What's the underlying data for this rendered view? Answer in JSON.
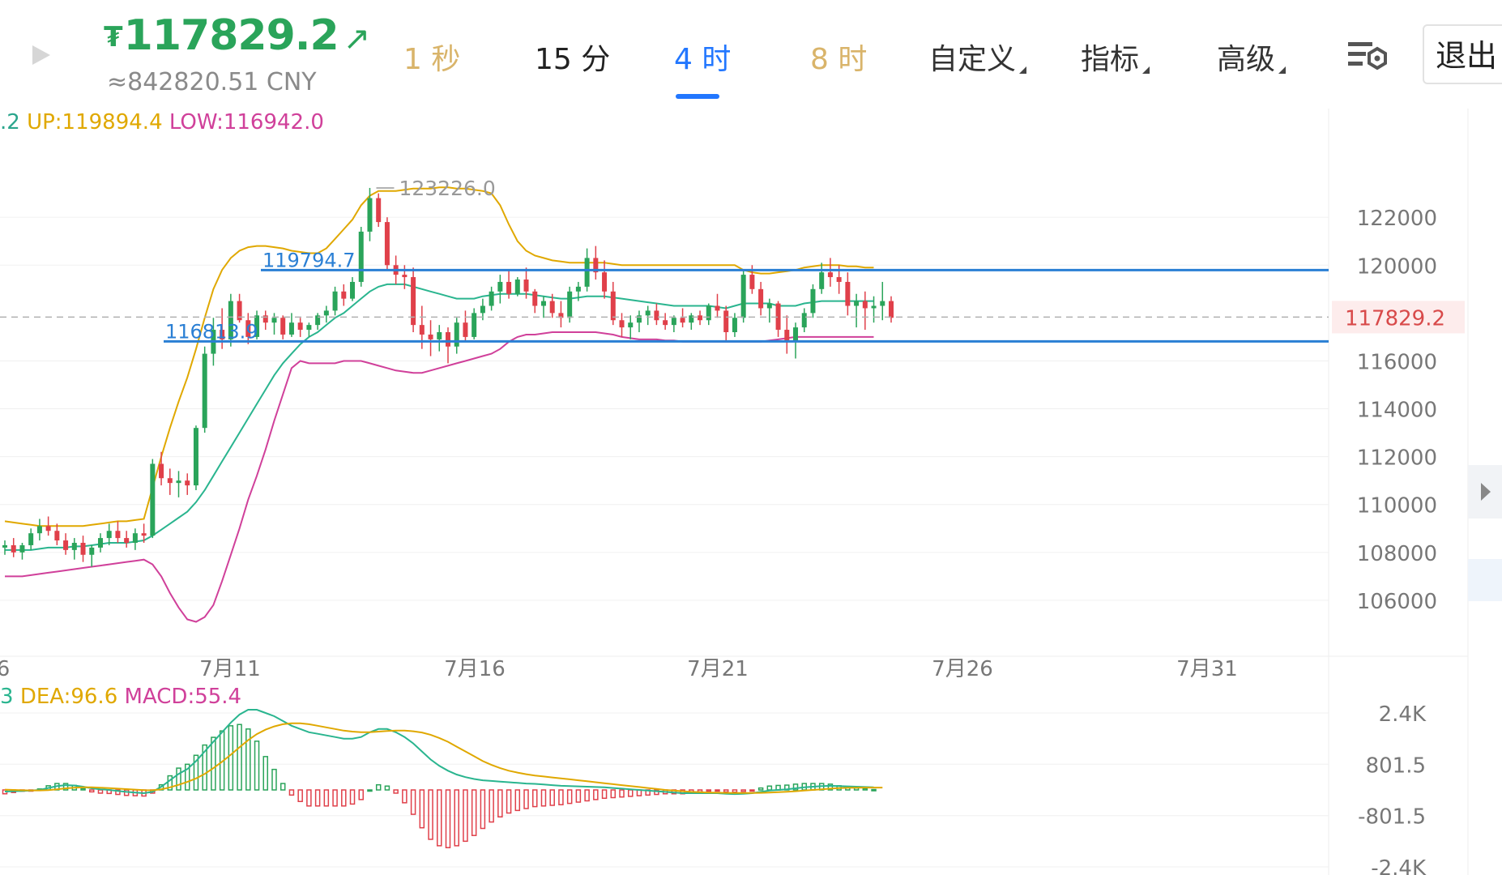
{
  "header": {
    "currency_symbol": "₮",
    "price": "117829.2",
    "price_arrow": "↗",
    "cny_value": "≈842820.51 CNY",
    "price_color": "#2aa45a"
  },
  "timeframes": [
    {
      "label": "1 秒",
      "state": "gold"
    },
    {
      "label": "15 分",
      "state": "normal"
    },
    {
      "label": "4 时",
      "state": "active"
    },
    {
      "label": "8 时",
      "state": "gold"
    }
  ],
  "menus": {
    "custom": "自定义",
    "indicators": "指标",
    "advanced": "高级"
  },
  "exit_label": "退出",
  "legend": {
    "mid_fragment": ".2",
    "up": "UP:119894.4",
    "low": "LOW:116942.0",
    "up_color": "#e0a800",
    "low_color": "#d0409a",
    "mid_color": "#2aa58c"
  },
  "macd_legend": {
    "dif_fragment": "3",
    "dea": "DEA:96.6",
    "macd": "MACD:55.4"
  },
  "annotations": {
    "high_marker": "123226.0",
    "resistance_label": "119794.7",
    "support_label": "116813.9",
    "current_price_tag": "117829.2"
  },
  "colors": {
    "up_candle": "#2aa45a",
    "down_candle": "#e0404a",
    "boll_upper": "#e0a800",
    "boll_mid": "#2ab58f",
    "boll_lower": "#d0409a",
    "level_line": "#2a7fd4",
    "grid": "#f0f0f0",
    "axis_text": "#777777"
  },
  "chart_data": {
    "type": "candlestick",
    "y_ticks": [
      122000,
      120000,
      116000,
      114000,
      112000,
      110000,
      108000,
      106000
    ],
    "y_range": [
      104000,
      126000
    ],
    "x_ticks": [
      "6",
      "7月11",
      "7月16",
      "7月21",
      "7月26",
      "7月31"
    ],
    "horizontal_levels": [
      119794.7,
      116813.9
    ],
    "current_price": 117829.2,
    "max_high": 123226.0,
    "candles_ohlc": [
      [
        108200,
        108500,
        107900,
        108300
      ],
      [
        108300,
        108600,
        107800,
        108000
      ],
      [
        108000,
        108400,
        107700,
        108300
      ],
      [
        108300,
        109000,
        108100,
        108800
      ],
      [
        108800,
        109400,
        108500,
        109100
      ],
      [
        109100,
        109500,
        108700,
        108900
      ],
      [
        108900,
        109200,
        108300,
        108500
      ],
      [
        108500,
        108800,
        107900,
        108100
      ],
      [
        108100,
        108600,
        107700,
        108400
      ],
      [
        108400,
        108700,
        107600,
        107900
      ],
      [
        107900,
        108300,
        107400,
        108200
      ],
      [
        108200,
        108800,
        108000,
        108600
      ],
      [
        108600,
        109200,
        108300,
        108900
      ],
      [
        108900,
        109300,
        108400,
        108600
      ],
      [
        108600,
        108900,
        108200,
        108400
      ],
      [
        108400,
        109000,
        108100,
        108800
      ],
      [
        108800,
        109200,
        108400,
        108700
      ],
      [
        108700,
        111900,
        108600,
        111700
      ],
      [
        111700,
        112200,
        110800,
        111100
      ],
      [
        111100,
        111500,
        110400,
        110900
      ],
      [
        110900,
        111400,
        110300,
        111000
      ],
      [
        111000,
        111300,
        110400,
        110800
      ],
      [
        110800,
        113300,
        110600,
        113200
      ],
      [
        113200,
        116600,
        113000,
        116300
      ],
      [
        116300,
        117800,
        115800,
        117300
      ],
      [
        117300,
        118200,
        116500,
        116900
      ],
      [
        116900,
        118800,
        116600,
        118500
      ],
      [
        118500,
        118800,
        117600,
        117700
      ],
      [
        117700,
        118000,
        116700,
        117000
      ],
      [
        117000,
        118100,
        116900,
        117900
      ],
      [
        117900,
        118100,
        117300,
        117600
      ],
      [
        117600,
        118000,
        117100,
        117800
      ],
      [
        117800,
        117900,
        116900,
        117100
      ],
      [
        117100,
        118000,
        117000,
        117600
      ],
      [
        117600,
        117800,
        117000,
        117300
      ],
      [
        117300,
        117600,
        117000,
        117500
      ],
      [
        117500,
        118000,
        117300,
        117900
      ],
      [
        117900,
        118300,
        117600,
        118100
      ],
      [
        118100,
        119100,
        117900,
        118900
      ],
      [
        118900,
        119200,
        118300,
        118600
      ],
      [
        118600,
        119500,
        118500,
        119300
      ],
      [
        119300,
        121600,
        119100,
        121400
      ],
      [
        121400,
        123226,
        121000,
        122800
      ],
      [
        122800,
        123000,
        121600,
        121800
      ],
      [
        121800,
        122000,
        119800,
        120000
      ],
      [
        120000,
        120400,
        119200,
        119600
      ],
      [
        119600,
        120000,
        119000,
        119500
      ],
      [
        119500,
        119900,
        117200,
        117500
      ],
      [
        117500,
        118300,
        116500,
        117100
      ],
      [
        117100,
        117700,
        116200,
        116900
      ],
      [
        116900,
        117500,
        116400,
        117200
      ],
      [
        117200,
        117400,
        115900,
        116600
      ],
      [
        116600,
        117800,
        116300,
        117600
      ],
      [
        117600,
        118100,
        116800,
        117000
      ],
      [
        117000,
        118200,
        116900,
        118000
      ],
      [
        118000,
        118600,
        117700,
        118300
      ],
      [
        118300,
        119100,
        118100,
        118900
      ],
      [
        118900,
        119600,
        118400,
        119300
      ],
      [
        119300,
        119800,
        118600,
        118800
      ],
      [
        118800,
        119500,
        118700,
        119400
      ],
      [
        119400,
        119900,
        118600,
        118900
      ],
      [
        118900,
        119000,
        118000,
        118300
      ],
      [
        118300,
        118700,
        117800,
        118500
      ],
      [
        118500,
        118800,
        117800,
        118000
      ],
      [
        118000,
        118500,
        117400,
        117800
      ],
      [
        117800,
        119100,
        117600,
        118900
      ],
      [
        118900,
        119300,
        118500,
        119100
      ],
      [
        119100,
        120700,
        118900,
        120300
      ],
      [
        120300,
        120800,
        119400,
        119700
      ],
      [
        119700,
        120200,
        118600,
        118900
      ],
      [
        118900,
        119300,
        117500,
        117700
      ],
      [
        117700,
        118000,
        117000,
        117400
      ],
      [
        117400,
        117900,
        116900,
        117600
      ],
      [
        117600,
        118100,
        117200,
        117900
      ],
      [
        117900,
        118300,
        117500,
        118100
      ],
      [
        118100,
        118400,
        117500,
        117700
      ],
      [
        117700,
        118000,
        117300,
        117500
      ],
      [
        117500,
        117900,
        117200,
        117800
      ],
      [
        117800,
        118200,
        117400,
        117600
      ],
      [
        117600,
        118000,
        117300,
        117900
      ],
      [
        117900,
        118100,
        117500,
        117700
      ],
      [
        117700,
        118400,
        117500,
        118300
      ],
      [
        118300,
        118800,
        117800,
        118100
      ],
      [
        118100,
        118300,
        116800,
        117200
      ],
      [
        117200,
        118000,
        117000,
        117800
      ],
      [
        117800,
        119800,
        117600,
        119600
      ],
      [
        119600,
        120000,
        118800,
        119000
      ],
      [
        119000,
        119300,
        117900,
        118200
      ],
      [
        118200,
        118600,
        117600,
        118400
      ],
      [
        118400,
        118500,
        117000,
        117300
      ],
      [
        117300,
        117900,
        116300,
        116800
      ],
      [
        116800,
        117600,
        116100,
        117400
      ],
      [
        117400,
        118200,
        117200,
        118000
      ],
      [
        118000,
        119200,
        117800,
        119000
      ],
      [
        119000,
        120100,
        118800,
        119700
      ],
      [
        119700,
        120300,
        119100,
        119500
      ],
      [
        119500,
        120000,
        118800,
        119300
      ],
      [
        119300,
        119700,
        117900,
        118300
      ],
      [
        118300,
        118800,
        117400,
        118500
      ],
      [
        118500,
        118900,
        117300,
        118200
      ],
      [
        118200,
        118700,
        117600,
        118300
      ],
      [
        118300,
        119300,
        117700,
        118500
      ],
      [
        118500,
        118700,
        117600,
        117800
      ]
    ],
    "boll_upper": [
      109300,
      109250,
      109200,
      109150,
      109100,
      109100,
      109100,
      109100,
      109100,
      109100,
      109150,
      109200,
      109250,
      109300,
      109300,
      109350,
      109400,
      110700,
      112000,
      113200,
      114300,
      115300,
      116500,
      117800,
      119000,
      119800,
      120300,
      120600,
      120750,
      120800,
      120800,
      120750,
      120700,
      120600,
      120550,
      120500,
      120500,
      120700,
      121100,
      121500,
      121900,
      122500,
      122900,
      123100,
      123100,
      123100,
      123150,
      123200,
      123200,
      123200,
      123250,
      123250,
      123200,
      123200,
      123150,
      123100,
      123000,
      122500,
      121700,
      121000,
      120600,
      120400,
      120300,
      120200,
      120150,
      120100,
      120100,
      120100,
      120100,
      120100,
      120050,
      120000,
      120000,
      120000,
      120000,
      120000,
      120000,
      120000,
      120000,
      120000,
      120000,
      120000,
      120000,
      120000,
      120000,
      119800,
      119700,
      119650,
      119650,
      119700,
      119750,
      119800,
      119900,
      119950,
      120000,
      120000,
      120000,
      119950,
      119950,
      119900,
      119900
    ],
    "boll_mid": [
      108100,
      108100,
      108100,
      108100,
      108150,
      108200,
      108200,
      108200,
      108250,
      108250,
      108300,
      108350,
      108400,
      108400,
      108400,
      108450,
      108500,
      108700,
      108950,
      109200,
      109450,
      109700,
      110100,
      110600,
      111200,
      111800,
      112400,
      113000,
      113600,
      114200,
      114800,
      115400,
      115900,
      116300,
      116700,
      117000,
      117200,
      117500,
      117800,
      118000,
      118300,
      118600,
      118900,
      119100,
      119200,
      119200,
      119200,
      119100,
      119000,
      118900,
      118800,
      118700,
      118600,
      118600,
      118600,
      118700,
      118750,
      118800,
      118800,
      118800,
      118800,
      118750,
      118700,
      118650,
      118600,
      118600,
      118650,
      118700,
      118700,
      118700,
      118650,
      118600,
      118550,
      118500,
      118450,
      118400,
      118350,
      118300,
      118300,
      118300,
      118300,
      118300,
      118250,
      118200,
      118300,
      118400,
      118400,
      118400,
      118400,
      118300,
      118300,
      118300,
      118400,
      118450,
      118500,
      118500,
      118500,
      118500,
      118500,
      118500,
      118500
    ],
    "boll_lower": [
      107000,
      107000,
      107000,
      107050,
      107100,
      107150,
      107200,
      107250,
      107300,
      107350,
      107400,
      107450,
      107500,
      107550,
      107600,
      107650,
      107700,
      107500,
      107000,
      106300,
      105700,
      105200,
      105100,
      105300,
      105800,
      106800,
      107900,
      109000,
      110200,
      111200,
      112300,
      113500,
      114600,
      115700,
      116000,
      115900,
      115900,
      115900,
      115900,
      116000,
      116000,
      116000,
      115900,
      115800,
      115700,
      115600,
      115550,
      115500,
      115500,
      115600,
      115700,
      115800,
      115900,
      116000,
      116100,
      116200,
      116300,
      116500,
      116800,
      117000,
      117100,
      117100,
      117150,
      117200,
      117200,
      117200,
      117200,
      117200,
      117200,
      117150,
      117100,
      117000,
      116950,
      116900,
      116900,
      116900,
      116850,
      116850,
      116800,
      116800,
      116800,
      116800,
      116800,
      116800,
      116800,
      116800,
      116800,
      116800,
      116850,
      116900,
      116950,
      117000,
      117000,
      117000,
      117000,
      117000,
      117000,
      117000,
      117000,
      117000,
      117000
    ],
    "macd_ticks": [
      "2.4K",
      "801.5",
      "-801.5",
      "-2.4K"
    ],
    "macd_range": [
      -2400,
      2400
    ],
    "macd_dif": [
      -50,
      -40,
      -30,
      -20,
      0,
      60,
      120,
      150,
      140,
      100,
      50,
      20,
      0,
      -30,
      -60,
      -80,
      -100,
      -60,
      100,
      300,
      500,
      650,
      900,
      1200,
      1500,
      1800,
      2100,
      2350,
      2500,
      2500,
      2400,
      2300,
      2150,
      2000,
      1900,
      1800,
      1750,
      1700,
      1650,
      1600,
      1600,
      1650,
      1800,
      1900,
      1900,
      1800,
      1650,
      1450,
      1200,
      950,
      750,
      600,
      480,
      400,
      340,
      300,
      280,
      260,
      240,
      220,
      200,
      190,
      170,
      150,
      130,
      120,
      110,
      100,
      90,
      80,
      60,
      40,
      20,
      0,
      -20,
      -40,
      -60,
      -80,
      -100,
      -100,
      -100,
      -100,
      -100,
      -120,
      -130,
      -120,
      -100,
      -60,
      -20,
      0,
      20,
      50,
      80,
      100,
      120,
      130,
      120,
      110,
      100,
      90,
      80
    ],
    "macd_dea": [
      10,
      0,
      -10,
      -15,
      -15,
      -5,
      20,
      50,
      70,
      80,
      80,
      70,
      55,
      40,
      25,
      10,
      -5,
      -10,
      20,
      80,
      160,
      250,
      360,
      500,
      680,
      880,
      1100,
      1330,
      1550,
      1740,
      1880,
      1980,
      2050,
      2080,
      2080,
      2050,
      2000,
      1950,
      1900,
      1850,
      1820,
      1800,
      1800,
      1820,
      1840,
      1850,
      1850,
      1830,
      1790,
      1720,
      1620,
      1500,
      1350,
      1200,
      1050,
      900,
      780,
      680,
      600,
      540,
      490,
      450,
      420,
      390,
      360,
      330,
      300,
      270,
      240,
      210,
      180,
      150,
      120,
      90,
      60,
      30,
      0,
      -20,
      -40,
      -60,
      -70,
      -80,
      -85,
      -90,
      -95,
      -95,
      -95,
      -90,
      -80,
      -70,
      -55,
      -40,
      -20,
      0,
      20,
      40,
      55,
      65,
      70,
      72,
      74,
      74
    ],
    "macd_hist": [
      -120,
      -80,
      -40,
      -10,
      30,
      130,
      200,
      200,
      140,
      40,
      -60,
      -100,
      -110,
      -140,
      -170,
      -180,
      -190,
      -100,
      160,
      440,
      680,
      800,
      1080,
      1400,
      1640,
      1840,
      2000,
      2040,
      1900,
      1520,
      1040,
      640,
      200,
      -160,
      -360,
      -500,
      -500,
      -500,
      -500,
      -500,
      -440,
      -300,
      0,
      160,
      120,
      -100,
      -400,
      -760,
      -1180,
      -1540,
      -1740,
      -1800,
      -1740,
      -1600,
      -1420,
      -1200,
      -1000,
      -840,
      -720,
      -640,
      -580,
      -520,
      -500,
      -480,
      -460,
      -420,
      -380,
      -340,
      -300,
      -260,
      -240,
      -220,
      -200,
      -180,
      -160,
      -140,
      -120,
      -120,
      -120,
      -80,
      -60,
      -40,
      -30,
      -60,
      -70,
      -50,
      -10,
      60,
      120,
      140,
      150,
      180,
      200,
      200,
      200,
      180,
      130,
      90,
      60,
      40,
      12
    ]
  }
}
